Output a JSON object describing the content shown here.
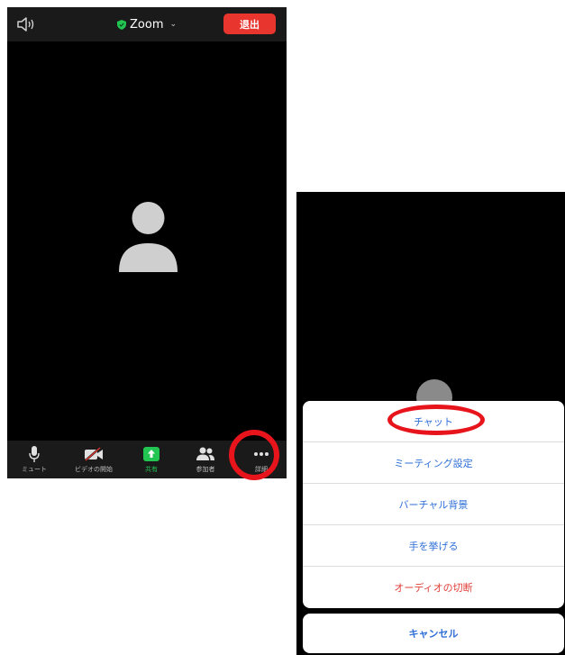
{
  "left_screen": {
    "header": {
      "title": "Zoom",
      "title_chevron": "⌄",
      "leave_label": "退出"
    },
    "toolbar": [
      {
        "label": "ミュート",
        "icon": "microphone-icon"
      },
      {
        "label": "ビデオの開始",
        "icon": "video-off-icon"
      },
      {
        "label": "共有",
        "icon": "share-screen-icon"
      },
      {
        "label": "参加者",
        "icon": "participants-icon"
      },
      {
        "label": "詳細",
        "icon": "more-icon"
      }
    ]
  },
  "right_screen": {
    "menu_items": [
      {
        "label": "チャット"
      },
      {
        "label": "ミーティング設定"
      },
      {
        "label": "バーチャル背景"
      },
      {
        "label": "手を挙げる"
      },
      {
        "label": "オーディオの切断"
      }
    ],
    "cancel_label": "キャンセル"
  },
  "colors": {
    "leave_red": "#e8352e",
    "highlight_ring": "#e8141c",
    "share_green": "#23c552",
    "link_blue": "#2f6fd6",
    "danger_red": "#e0403a"
  }
}
